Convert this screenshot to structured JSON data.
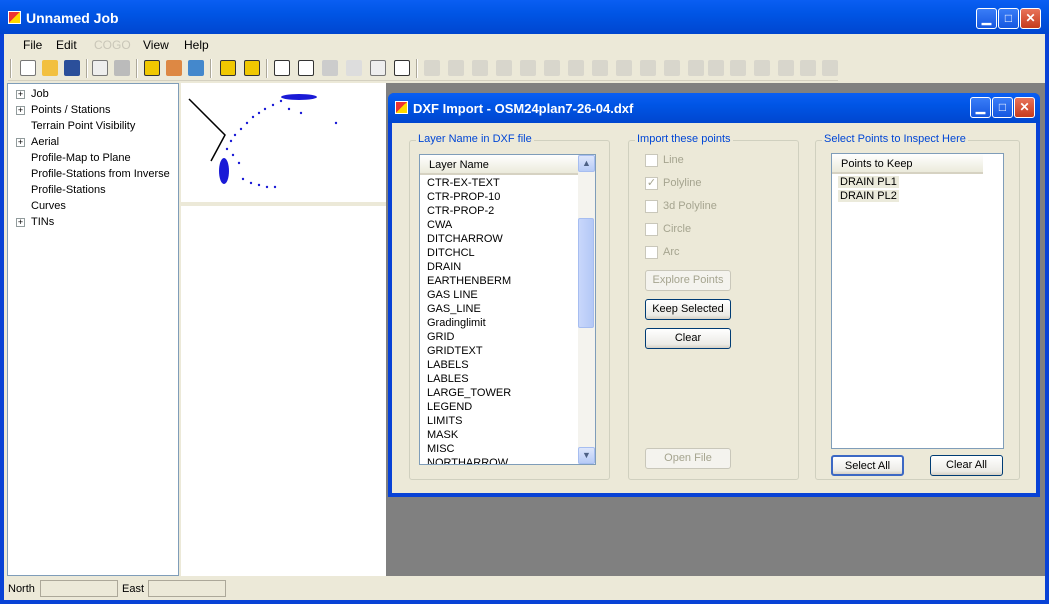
{
  "app": {
    "title": "Unnamed Job"
  },
  "menu": {
    "file": "File",
    "edit": "Edit",
    "cogo": "COGO",
    "view": "View",
    "help": "Help"
  },
  "tree": {
    "items": [
      {
        "label": "Job",
        "expandable": true
      },
      {
        "label": "Points / Stations",
        "expandable": true
      },
      {
        "label": "Terrain Point Visibility",
        "expandable": false
      },
      {
        "label": "Aerial",
        "expandable": true
      },
      {
        "label": "Profile-Map to Plane",
        "expandable": false
      },
      {
        "label": "Profile-Stations from Inverse",
        "expandable": false
      },
      {
        "label": "Profile-Stations",
        "expandable": false
      },
      {
        "label": "Curves",
        "expandable": false
      },
      {
        "label": "TINs",
        "expandable": true
      }
    ]
  },
  "status": {
    "north_label": "North",
    "north_value": "",
    "east_label": "East",
    "east_value": ""
  },
  "dialog": {
    "title": "DXF Import - OSM24plan7-26-04.dxf",
    "layers": {
      "group_label": "Layer Name in DXF file",
      "column": "Layer Name",
      "items": [
        "CTR-EX-TEXT",
        "CTR-PROP-10",
        "CTR-PROP-2",
        "CWA",
        "DITCHARROW",
        "DITCHCL",
        "DRAIN",
        "EARTHENBERM",
        "GAS LINE",
        "GAS_LINE",
        "Gradinglimit",
        "GRID",
        "GRIDTEXT",
        "LABELS",
        "LABLES",
        "LARGE_TOWER",
        "LEGEND",
        "LIMITS",
        "MASK",
        "MISC",
        "NORTHARROW"
      ]
    },
    "import": {
      "group_label": "Import these points",
      "options": [
        {
          "label": "Line",
          "checked": false
        },
        {
          "label": "Polyline",
          "checked": true
        },
        {
          "label": "3d Polyline",
          "checked": false
        },
        {
          "label": "Circle",
          "checked": false
        },
        {
          "label": "Arc",
          "checked": false
        }
      ],
      "explore": "Explore Points",
      "keep": "Keep Selected",
      "clear": "Clear",
      "open": "Open File"
    },
    "inspect": {
      "group_label": "Select Points to Inspect Here",
      "column": "Points to Keep",
      "items": [
        "DRAIN PL1",
        "DRAIN PL2"
      ],
      "select_all": "Select  All",
      "clear_all": "Clear All"
    }
  },
  "colors": {
    "title_blue": "#0055e5",
    "legend_blue": "#0046d5",
    "plot_points": "#1a1ad6"
  }
}
